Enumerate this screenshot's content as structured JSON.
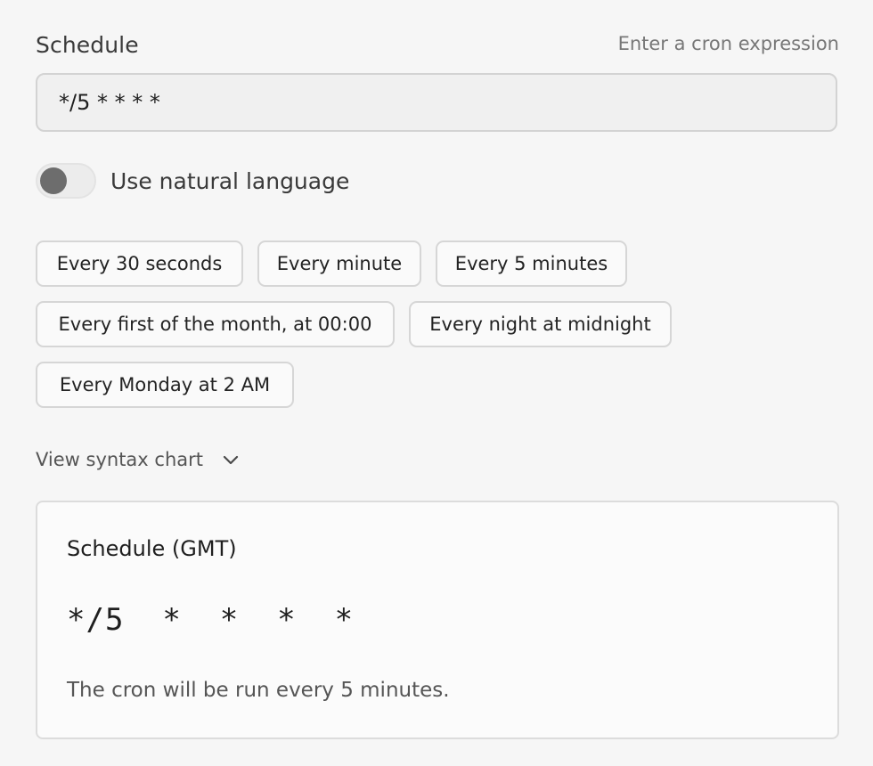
{
  "schedule": {
    "label": "Schedule",
    "hint": "Enter a cron expression",
    "value": "*/5 * * * *"
  },
  "natural_language": {
    "label": "Use natural language",
    "enabled": false
  },
  "presets": [
    "Every 30 seconds",
    "Every minute",
    "Every 5 minutes",
    "Every first of the month, at 00:00",
    "Every night at midnight",
    "Every Monday at 2 AM"
  ],
  "syntax_chart": {
    "label": "View syntax chart",
    "icon": "chevron-down-icon"
  },
  "summary": {
    "title": "Schedule (GMT)",
    "expression": "*/5  *  *  *  *",
    "description": "The cron will be run every 5 minutes."
  }
}
